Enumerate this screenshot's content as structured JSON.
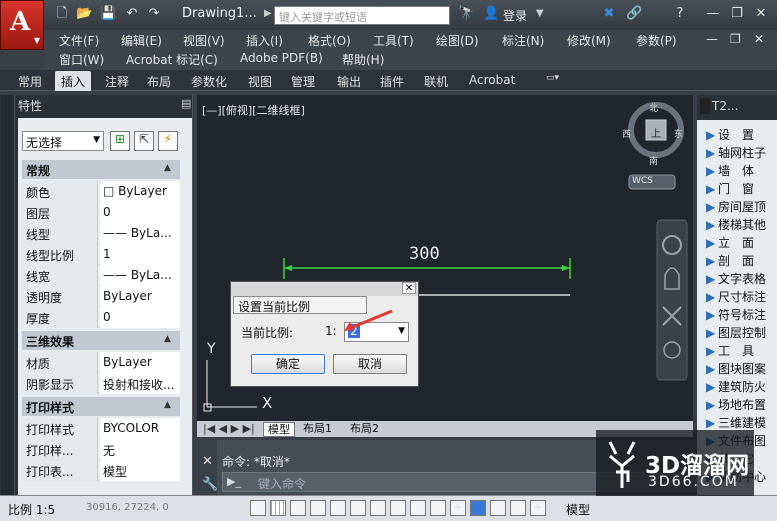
{
  "title_bar": {
    "doc_title": "Drawing1...",
    "search_placeholder": "键入关键字或短语",
    "login": "登录"
  },
  "menus": {
    "row1": [
      "文件(F)",
      "编辑(E)",
      "视图(V)",
      "插入(I)",
      "格式(O)",
      "工具(T)",
      "绘图(D)",
      "标注(N)",
      "修改(M)",
      "参数(P)"
    ],
    "row2": [
      "窗口(W)",
      "Acrobat 标记(C)",
      "Adobe PDF(B)",
      "帮助(H)"
    ]
  },
  "ribbon_tabs": [
    "常用",
    "插入",
    "注释",
    "布局",
    "参数化",
    "视图",
    "管理",
    "输出",
    "插件",
    "联机",
    "Acrobat"
  ],
  "ribbon_active_index": 1,
  "properties": {
    "title": "特性",
    "selection": "无选择",
    "sections": [
      {
        "name": "常规",
        "rows": [
          [
            "颜色",
            "□ ByLayer"
          ],
          [
            "图层",
            "0"
          ],
          [
            "线型",
            "—— ByLa..."
          ],
          [
            "线型比例",
            "1"
          ],
          [
            "线宽",
            "—— ByLa..."
          ],
          [
            "透明度",
            "ByLayer"
          ],
          [
            "厚度",
            "0"
          ]
        ]
      },
      {
        "name": "三维效果",
        "rows": [
          [
            "材质",
            "ByLayer"
          ],
          [
            "阴影显示",
            "投射和接收..."
          ]
        ]
      },
      {
        "name": "打印样式",
        "rows": [
          [
            "打印样式",
            "BYCOLOR"
          ],
          [
            "打印样...",
            "无"
          ],
          [
            "打印表...",
            "模型"
          ]
        ]
      }
    ]
  },
  "canvas": {
    "view_label": "[—][俯视][二维线框]",
    "dimension": "300",
    "viewcube": {
      "n": "北",
      "s": "南",
      "w": "西",
      "e": "东",
      "top": "上"
    },
    "wcs": "WCS",
    "ucs_x": "X",
    "ucs_y": "Y"
  },
  "dialog": {
    "title": "设置当前比例",
    "label": "当前比例:",
    "ratio_prefix": "1:",
    "value": "2",
    "ok": "确定",
    "cancel": "取消"
  },
  "layout_tabs": [
    "模型",
    "布局1",
    "布局2"
  ],
  "command": {
    "history": "命令: *取消*",
    "prompt": "键入命令"
  },
  "status": {
    "scale": "比例 1:5",
    "coords": "30916, 27224, 0",
    "model": "模型"
  },
  "right_panel": {
    "title": "T2...",
    "items": [
      "设　置",
      "轴网柱子",
      "墙　体",
      "门　窗",
      "房间屋顶",
      "楼梯其他",
      "立　面",
      "剖　面",
      "文字表格",
      "尺寸标注",
      "符号标注",
      "图层控制",
      "工　具",
      "图块图案",
      "建筑防火",
      "场地布置",
      "三维建模",
      "文件布图",
      "其　它",
      "帮助中心"
    ]
  },
  "watermark": {
    "logo": "3D溜溜网",
    "url": "3D66.COM"
  },
  "colors": {
    "accent_red": "#e53a2f",
    "dim_green": "#39d339",
    "canvas_bg": "#21262d"
  }
}
